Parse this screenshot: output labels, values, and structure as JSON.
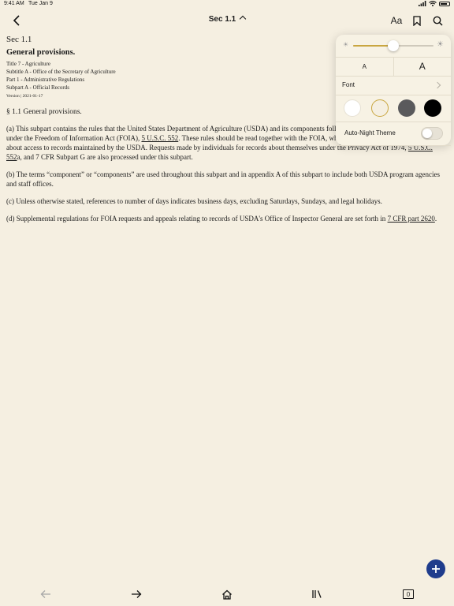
{
  "status": {
    "time": "9:41 AM",
    "date": "Tue Jan 9"
  },
  "nav": {
    "title": "Sec 1.1",
    "font_button_label": "Aa"
  },
  "document": {
    "section_number": "Sec 1.1",
    "title": "General provisions.",
    "meta": [
      "Title 7 - Agriculture",
      "Subtitle A - Office of the Secretary of Agriculture",
      "Part 1 - Administrative Regulations",
      "Subpart A - Official Records"
    ],
    "version": "Version | 2021-01-17",
    "heading": "§ 1.1 General provisions.",
    "para_a": {
      "t1": "(a) This subpart contains the rules that the United States Department of Agriculture (USDA) and its components follow in processing requests for records under the Freedom of Information Act (FOIA), ",
      "link1": "5 U.S.C. 552",
      "t2": ". These rules should be read together with the FOIA, which provides additional information about access to records maintained by the USDA. Requests made by individuals for records about themselves under the Privacy Act of 1974, ",
      "link2": "5 U.S.C. 552",
      "t3": "a, and 7 CFR Subpart G are also processed under this subpart."
    },
    "para_b": "(b) The terms “component” or “components” are used throughout this subpart and in appendix A of this subpart to include both USDA program agencies and staff offices.",
    "para_c": "(c) Unless otherwise stated, references to number of days indicates business days, excluding Saturdays, Sundays, and legal holidays.",
    "para_d": {
      "t1": "(d) Supplemental regulations for FOIA requests and appeals relating to records of USDA's Office of Inspector General are set forth in ",
      "link": "7 CFR part 2620",
      "t2": "."
    }
  },
  "popover": {
    "brightness": 0.5,
    "small_text_label": "A",
    "large_text_label": "A",
    "font_label": "Font",
    "themes": [
      {
        "name": "white",
        "color": "#ffffff"
      },
      {
        "name": "sepia",
        "color": "#f5efe1",
        "selected": true
      },
      {
        "name": "gray",
        "color": "#5a5a5c"
      },
      {
        "name": "black",
        "color": "#000000"
      }
    ],
    "auto_night_label": "Auto-Night Theme",
    "auto_night_on": false
  },
  "toolbar": {
    "tab_count": "0"
  },
  "colors": {
    "background": "#f5efe1",
    "accent": "#c9a640",
    "fab": "#1f3c8c"
  }
}
